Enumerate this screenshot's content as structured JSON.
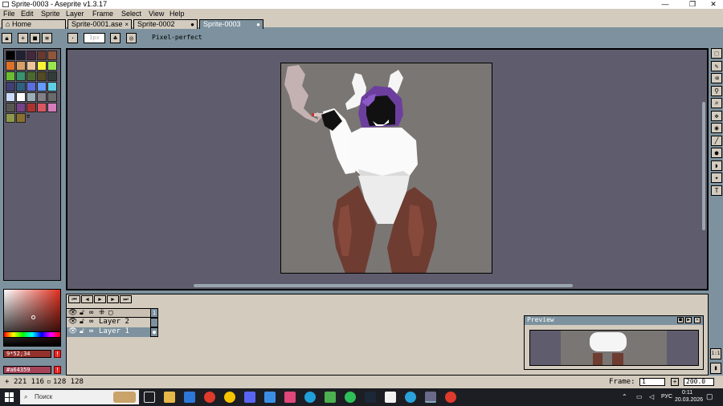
{
  "window": {
    "title": "Sprite-0003 - Aseprite v1.3.17",
    "minimize": "—",
    "maximize": "❐",
    "close": "✕"
  },
  "menu": [
    "File",
    "Edit",
    "Sprite",
    "Layer",
    "Frame",
    "Select",
    "View",
    "Help"
  ],
  "tabs": [
    {
      "label": "Home",
      "icon": "home-icon"
    },
    {
      "label": "Sprite-0001.ase",
      "closable": "×"
    },
    {
      "label": "Sprite-0002",
      "closable": "●"
    },
    {
      "label": "Sprite-0003",
      "closable": "●"
    }
  ],
  "context_bar": {
    "brush_size": "1px",
    "pixel_perfect_label": "Pixel-perfect"
  },
  "palette": {
    "colors": [
      "#000000",
      "#222034",
      "#45283c",
      "#663931",
      "#8f563b",
      "#df7126",
      "#d9a066",
      "#eec39a",
      "#fbf236",
      "#99e550",
      "#6abe30",
      "#37946e",
      "#4b692f",
      "#524b24",
      "#323c39",
      "#3f3f74",
      "#306082",
      "#5b6ee1",
      "#639bff",
      "#5fcde4",
      "#cbdbfc",
      "#ffffff",
      "#9badb7",
      "#847e87",
      "#696a6a",
      "#595652",
      "#76428a",
      "#ac3232",
      "#d95763",
      "#d77bba",
      "#8f974a",
      "#8a6f30"
    ],
    "more_label": "≡"
  },
  "color_fields": [
    {
      "value": "9*52;34",
      "bg": "#93322d"
    },
    {
      "value": "#a64359",
      "bg": "#a64359"
    }
  ],
  "timeline": {
    "controls": [
      "⏮",
      "◀",
      "▶",
      "▶",
      "⏭"
    ],
    "layers": [
      {
        "name": "",
        "selected": false
      },
      {
        "name": "Layer 2",
        "selected": false
      },
      {
        "name": "Layer 1",
        "selected": true
      }
    ],
    "frame_header": "1"
  },
  "preview": {
    "title": "Preview"
  },
  "status": {
    "position": "221 116",
    "size": "128 128",
    "frame_label": "Frame:",
    "frame_value": "1",
    "zoom": "200.0"
  },
  "right_tools": [
    "marquee-tool",
    "pencil-tool",
    "eraser-tool",
    "eyedropper-tool",
    "zoom-tool",
    "move-tool",
    "fill-tool",
    "line-tool",
    "ellipse-tool",
    "contour-tool",
    "blur-tool",
    "text-tool"
  ],
  "taskbar": {
    "search": "Поиск",
    "lang": "РУС",
    "time": "0:11",
    "date": "20.03.2026"
  }
}
